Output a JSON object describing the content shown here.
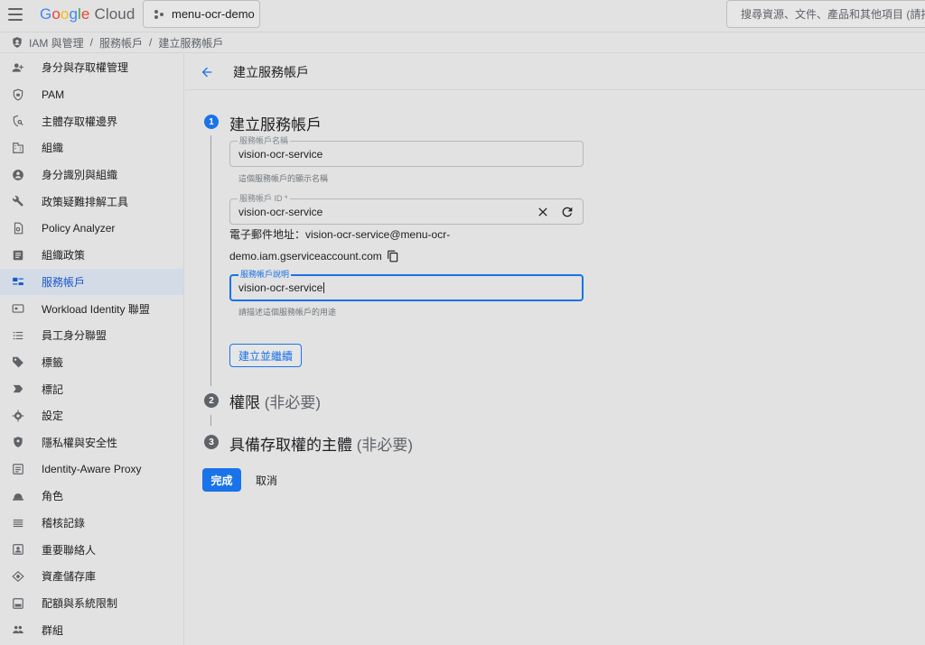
{
  "topbar": {
    "logo_letters": [
      "G",
      "o",
      "o",
      "g",
      "l",
      "e"
    ],
    "logo_product": "Cloud",
    "project_name": "menu-ocr-demo",
    "search_placeholder": "搜尋資源、文件、產品和其他項目 (請按"
  },
  "breadcrumb": {
    "items": [
      "IAM 與管理",
      "服務帳戶",
      "建立服務帳戶"
    ],
    "separator": "/"
  },
  "sidebar": {
    "active_index": 8,
    "items": [
      {
        "label": "身分與存取權管理",
        "icon": "person-add-icon"
      },
      {
        "label": "PAM",
        "icon": "shield-lock-icon"
      },
      {
        "label": "主體存取權邊界",
        "icon": "shield-search-icon"
      },
      {
        "label": "組織",
        "icon": "domain-icon"
      },
      {
        "label": "身分識別與組織",
        "icon": "account-circle-icon"
      },
      {
        "label": "政策疑難排解工具",
        "icon": "wrench-icon"
      },
      {
        "label": "Policy Analyzer",
        "icon": "document-search-icon"
      },
      {
        "label": "組織政策",
        "icon": "article-icon"
      },
      {
        "label": "服務帳戶",
        "icon": "service-account-icon"
      },
      {
        "label": "Workload Identity 聯盟",
        "icon": "badge-icon"
      },
      {
        "label": "員工身分聯盟",
        "icon": "list-icon"
      },
      {
        "label": "標籤",
        "icon": "tag-icon"
      },
      {
        "label": "標記",
        "icon": "label-icon"
      },
      {
        "label": "設定",
        "icon": "gear-icon"
      },
      {
        "label": "隱私權與安全性",
        "icon": "privacy-shield-icon"
      },
      {
        "label": "Identity-Aware Proxy",
        "icon": "proxy-icon"
      },
      {
        "label": "角色",
        "icon": "hat-icon"
      },
      {
        "label": "稽核記錄",
        "icon": "lines-icon"
      },
      {
        "label": "重要聯絡人",
        "icon": "contact-icon"
      },
      {
        "label": "資產儲存庫",
        "icon": "diamond-icon"
      },
      {
        "label": "配額與系統限制",
        "icon": "quota-icon"
      },
      {
        "label": "群組",
        "icon": "group-icon"
      }
    ]
  },
  "page": {
    "title": "建立服務帳戶"
  },
  "steps": [
    {
      "number": "1",
      "title": "建立服務帳戶",
      "optional": ""
    },
    {
      "number": "2",
      "title": "權限",
      "optional": "(非必要)"
    },
    {
      "number": "3",
      "title": "具備存取權的主體",
      "optional": "(非必要)"
    }
  ],
  "form": {
    "name_label": "服務帳戶名稱",
    "name_value": "vision-ocr-service",
    "name_hint": "這個服務帳戶的顯示名稱",
    "id_label": "服務帳戶 ID *",
    "id_value": "vision-ocr-service",
    "email_line1": "電子郵件地址：vision-ocr-service@menu-ocr-",
    "email_line2": "demo.iam.gserviceaccount.com",
    "desc_label": "服務帳戶說明",
    "desc_value": "vision-ocr-service",
    "desc_hint": "請描述這個服務帳戶的用途",
    "create_continue": "建立並繼續"
  },
  "actions": {
    "done": "完成",
    "cancel": "取消"
  },
  "colors": {
    "accent": "#1a73e8",
    "active_nav_bg": "#d3dbe7",
    "background": "#e2e2e2"
  }
}
